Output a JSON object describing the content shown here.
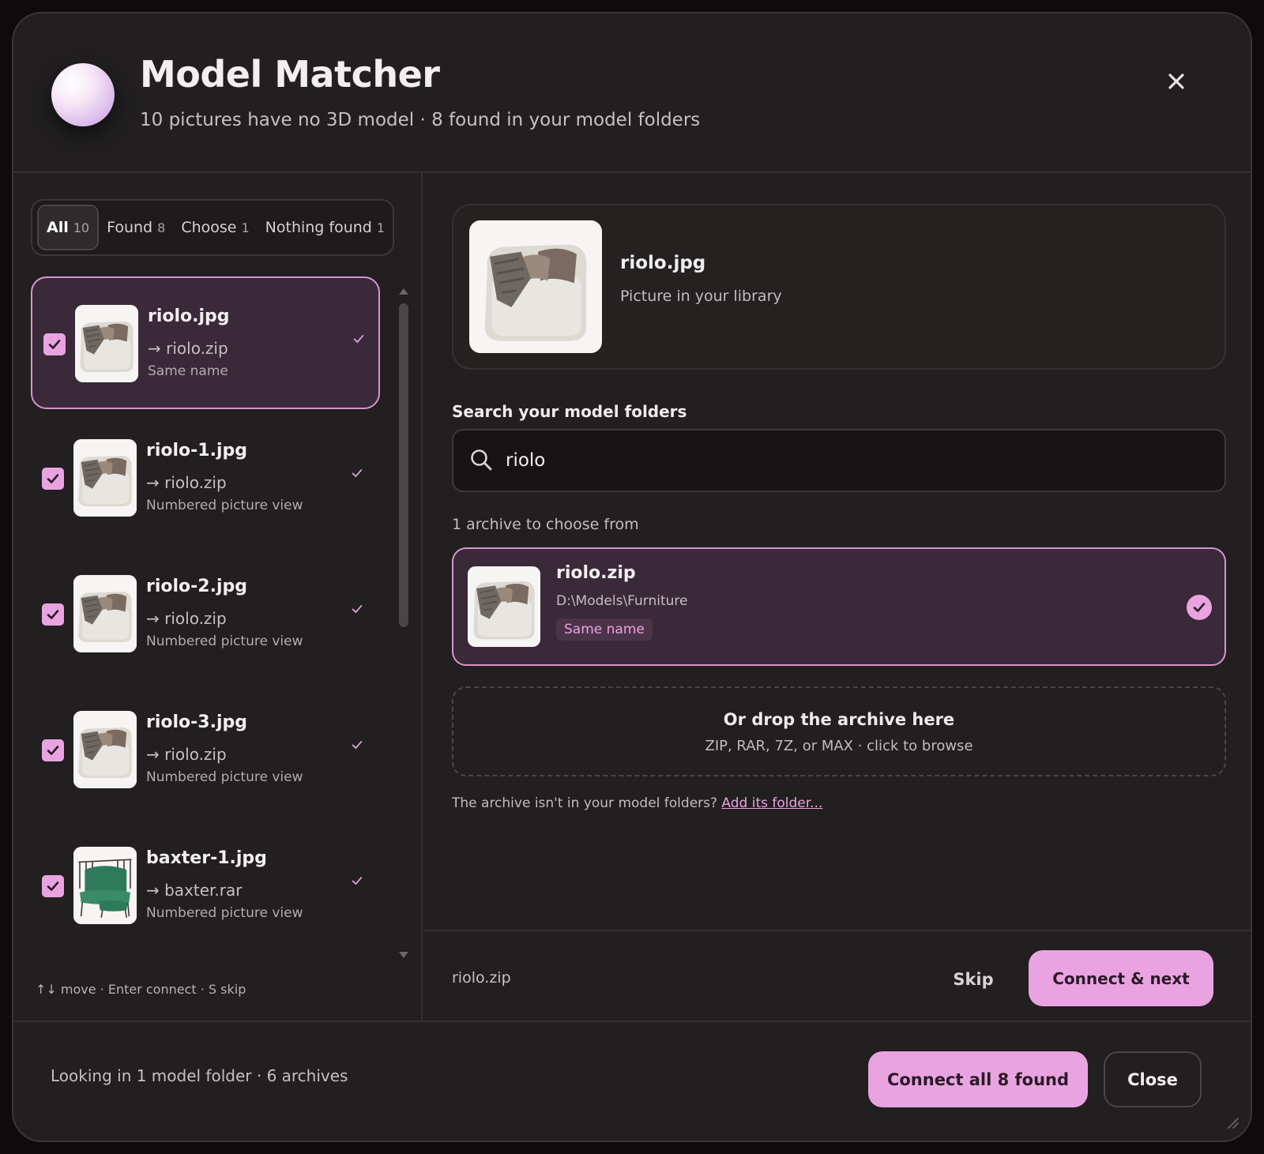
{
  "header": {
    "title": "Model Matcher",
    "subtitle": "10 pictures have no 3D model · 8 found in your model folders"
  },
  "tabs": [
    {
      "label": "All",
      "count": "10"
    },
    {
      "label": "Found",
      "count": "8"
    },
    {
      "label": "Choose",
      "count": "1"
    },
    {
      "label": "Nothing found",
      "count": "1"
    }
  ],
  "items": [
    {
      "name": "riolo.jpg",
      "archive": "→ riolo.zip",
      "reason": "Same name",
      "thumb": "armchair-thumb"
    },
    {
      "name": "riolo-1.jpg",
      "archive": "→ riolo.zip",
      "reason": "Numbered picture view",
      "thumb": "armchair-thumb"
    },
    {
      "name": "riolo-2.jpg",
      "archive": "→ riolo.zip",
      "reason": "Numbered picture view",
      "thumb": "armchair-thumb"
    },
    {
      "name": "riolo-3.jpg",
      "archive": "→ riolo.zip",
      "reason": "Numbered picture view",
      "thumb": "armchair-thumb"
    },
    {
      "name": "baxter-1.jpg",
      "archive": "→ baxter.rar",
      "reason": "Numbered picture view",
      "thumb": "green-chair-thumb"
    }
  ],
  "hint": "↑↓ move · Enter connect · S skip",
  "picture": {
    "name": "riolo.jpg",
    "subtitle": "Picture in your library"
  },
  "search": {
    "label": "Search your model folders",
    "value": "riolo",
    "results_count": "1 archive to choose from"
  },
  "archive": {
    "name": "riolo.zip",
    "path": "D:\\Models\\Furniture",
    "tag": "Same name"
  },
  "drop": {
    "title": "Or drop the archive here",
    "subtitle": "ZIP, RAR, 7Z, or MAX · click to browse"
  },
  "missing": {
    "text": "The archive isn't in your model folders?",
    "link": "Add its folder..."
  },
  "action_bar": {
    "selected_archive": "riolo.zip",
    "skip_label": "Skip",
    "next_label": "Connect & next"
  },
  "footer": {
    "status": "Looking in 1 model folder · 6 archives",
    "connect_all_label": "Connect all 8 found",
    "close_label": "Close"
  },
  "colors": {
    "accent": "#eaa3e1",
    "selected_bg": "#3a2939",
    "panel_bg": "#211f1f"
  }
}
